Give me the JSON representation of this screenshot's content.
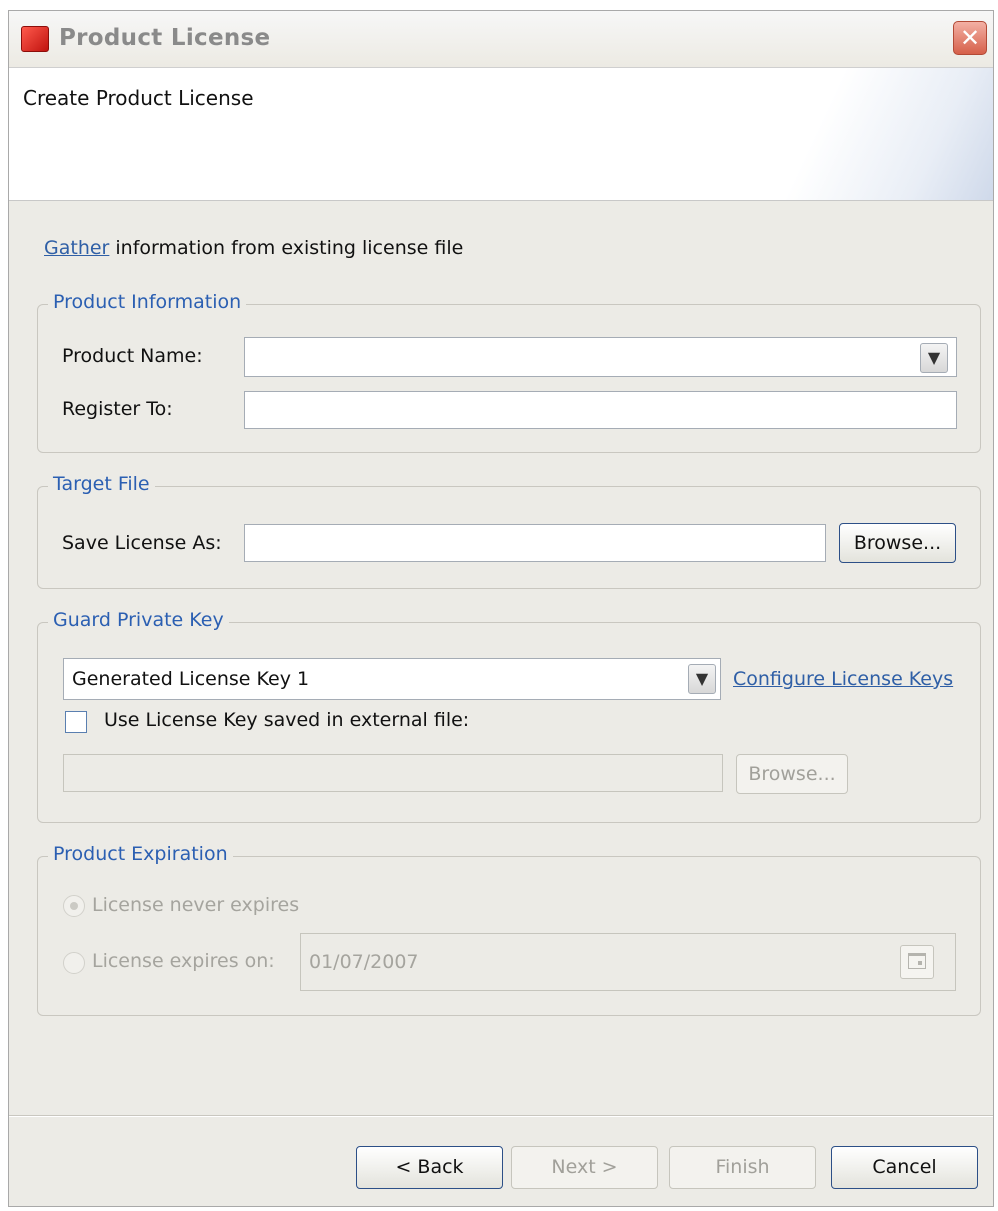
{
  "window": {
    "title": "Product License",
    "close_glyph": "✕"
  },
  "banner": {
    "title": "Create Product License"
  },
  "gather": {
    "link_text": "Gather",
    "rest_text": " information from existing license file"
  },
  "product_info": {
    "legend": "Product Information",
    "product_name_label": "Product Name:",
    "product_name_value": "",
    "register_to_label": "Register To:",
    "register_to_value": ""
  },
  "target_file": {
    "legend": "Target File",
    "save_as_label": "Save License As:",
    "save_as_value": "",
    "browse_label": "Browse..."
  },
  "guard_key": {
    "legend": "Guard Private Key",
    "selected_key": "Generated License Key 1",
    "configure_link": "Configure License Keys",
    "external_checkbox_label": "Use License Key saved in external file:",
    "external_checked": false,
    "external_path_value": "",
    "browse_label": "Browse..."
  },
  "expiration": {
    "legend": "Product Expiration",
    "never_label": "License never expires",
    "expires_on_label": "License expires on:",
    "date_value": "01/07/2007"
  },
  "footer": {
    "back_label": "< Back",
    "next_label": "Next >",
    "finish_label": "Finish",
    "cancel_label": "Cancel"
  },
  "icons": {
    "dropdown": "chevron-down-icon",
    "calendar": "calendar-icon"
  }
}
